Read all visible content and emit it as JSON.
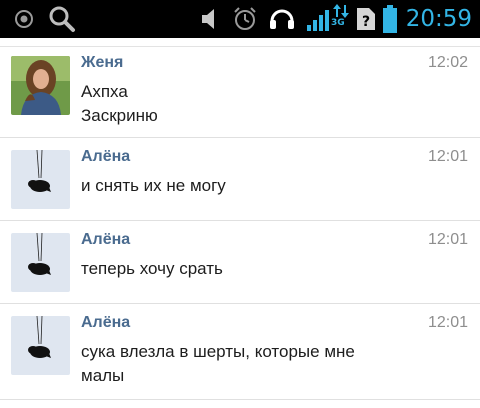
{
  "status_bar": {
    "time": "20:59",
    "network_type": "3G",
    "icons": [
      "target-icon",
      "search-icon",
      "volume-icon",
      "alarm-icon",
      "headset-icon",
      "signal-icon",
      "data-arrows-icon",
      "sim-unknown-icon",
      "battery-icon"
    ],
    "accent_color": "#33b5e5"
  },
  "messages": [
    {
      "sender": "Женя",
      "time": "12:02",
      "lines": [
        "Ахпха",
        "Заскриню"
      ],
      "avatar": "girl-photo"
    },
    {
      "sender": "Алёна",
      "time": "12:01",
      "lines": [
        "и снять их не могу"
      ],
      "avatar": "hanging-figure"
    },
    {
      "sender": "Алёна",
      "time": "12:01",
      "lines": [
        "теперь хочу срать"
      ],
      "avatar": "hanging-figure"
    },
    {
      "sender": "Алёна",
      "time": "12:01",
      "lines": [
        "сука влезла в шерты, которые мне",
        "малы"
      ],
      "avatar": "hanging-figure"
    }
  ],
  "colors": {
    "sender_name": "#4a6b8f",
    "timestamp": "#8e8e8e",
    "message_text": "#1d1d1d"
  }
}
